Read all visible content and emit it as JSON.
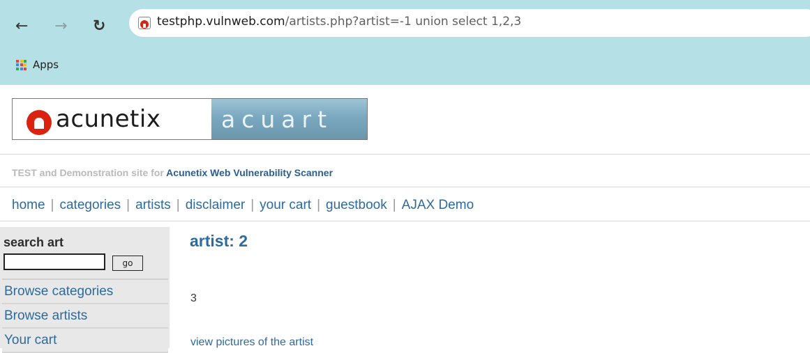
{
  "browser": {
    "url_host": "testphp.vulnweb.com",
    "url_path": "/artists.php?artist=-1 union select 1,2,3",
    "bookmarks": [
      {
        "label": "Apps",
        "icon": "apps-grid-icon"
      }
    ],
    "apps_colors": [
      "#ea4335",
      "#fbbc05",
      "#34a853",
      "#4285f4",
      "#ea4335",
      "#fbbc05",
      "#34a853",
      "#4285f4",
      "#ea4335"
    ],
    "nav_icons": [
      "back-arrow-icon",
      "forward-arrow-icon",
      "reload-icon"
    ]
  },
  "logo": {
    "brand": "acunetix",
    "product": "acuart"
  },
  "tagline": {
    "prefix": "TEST and Demonstration site for ",
    "highlight": "Acunetix Web Vulnerability Scanner"
  },
  "topnav": [
    "home",
    "categories",
    "artists",
    "disclaimer",
    "your cart",
    "guestbook",
    "AJAX Demo"
  ],
  "sidebar": {
    "search_title": "search art",
    "search_button": "go",
    "links": [
      "Browse categories",
      "Browse artists",
      "Your cart"
    ]
  },
  "main": {
    "title": "artist: 2",
    "body": "3",
    "link": "view pictures of the artist"
  }
}
